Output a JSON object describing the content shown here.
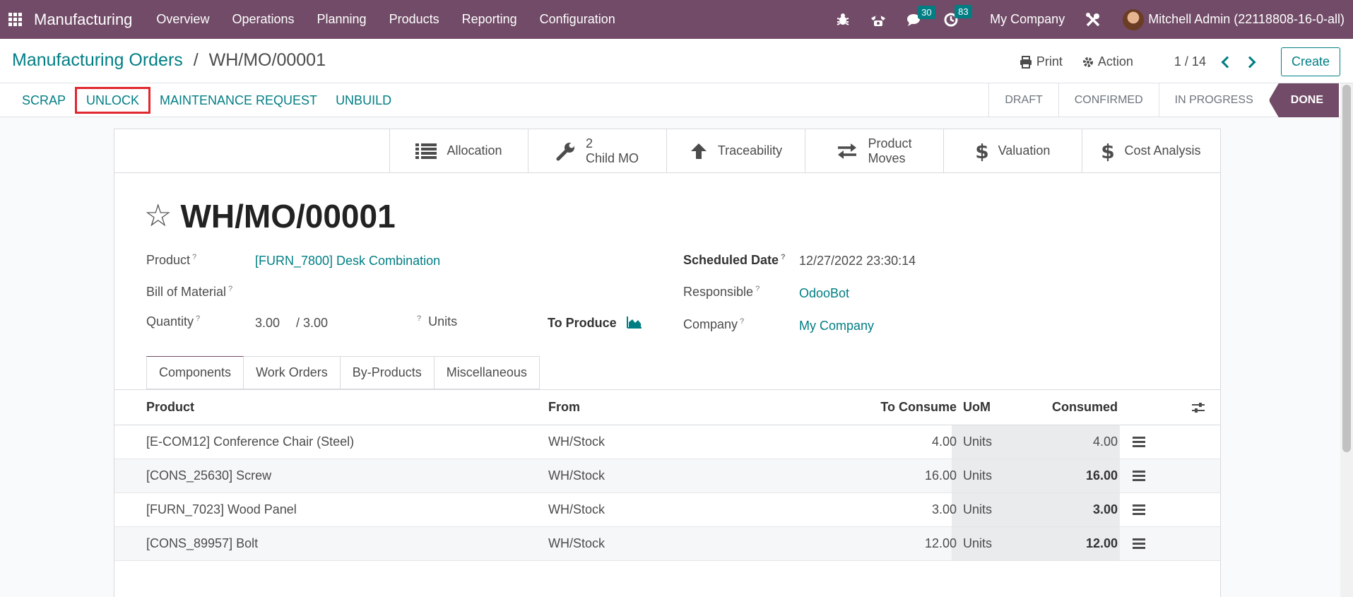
{
  "navbar": {
    "brand": "Manufacturing",
    "menu": [
      "Overview",
      "Operations",
      "Planning",
      "Products",
      "Reporting",
      "Configuration"
    ],
    "chat_count": "30",
    "activity_count": "83",
    "company": "My Company",
    "user": "Mitchell Admin (22118808-16-0-all)"
  },
  "breadcrumb": {
    "parent": "Manufacturing Orders",
    "separator": "/",
    "current": "WH/MO/00001"
  },
  "control": {
    "print": "Print",
    "action": "Action",
    "pager": "1 / 14",
    "create": "Create"
  },
  "header_buttons": {
    "scrap": "SCRAP",
    "unlock": "UNLOCK",
    "maintenance": "MAINTENANCE REQUEST",
    "unbuild": "UNBUILD"
  },
  "stages": [
    "DRAFT",
    "CONFIRMED",
    "IN PROGRESS",
    "DONE"
  ],
  "smart_buttons": {
    "allocation": "Allocation",
    "child_mo_count": "2",
    "child_mo": "Child MO",
    "traceability": "Traceability",
    "product_moves_1": "Product",
    "product_moves_2": "Moves",
    "valuation": "Valuation",
    "cost_analysis": "Cost Analysis"
  },
  "form": {
    "title": "WH/MO/00001",
    "product_label": "Product",
    "product_value": "[FURN_7800] Desk Combination",
    "bom_label": "Bill of Material",
    "quantity_label": "Quantity",
    "quantity_value": "3.00",
    "quantity_total": "/ 3.00",
    "uom_value": "Units",
    "to_produce_label": "To Produce",
    "scheduled_label": "Scheduled Date",
    "scheduled_value": "12/27/2022 23:30:14",
    "responsible_label": "Responsible",
    "responsible_value": "OdooBot",
    "company_label": "Company",
    "company_value": "My Company",
    "help_mark": "?"
  },
  "tabs": [
    "Components",
    "Work Orders",
    "By-Products",
    "Miscellaneous"
  ],
  "table": {
    "headers": {
      "product": "Product",
      "from": "From",
      "to_consume": "To Consume",
      "uom": "UoM",
      "consumed": "Consumed"
    },
    "rows": [
      {
        "product": "[E-COM12] Conference Chair (Steel)",
        "from": "WH/Stock",
        "to_consume": "4.00",
        "uom": "Units",
        "consumed": "4.00"
      },
      {
        "product": "[CONS_25630] Screw",
        "from": "WH/Stock",
        "to_consume": "16.00",
        "uom": "Units",
        "consumed": "16.00"
      },
      {
        "product": "[FURN_7023] Wood Panel",
        "from": "WH/Stock",
        "to_consume": "3.00",
        "uom": "Units",
        "consumed": "3.00"
      },
      {
        "product": "[CONS_89957] Bolt",
        "from": "WH/Stock",
        "to_consume": "12.00",
        "uom": "Units",
        "consumed": "12.00"
      }
    ]
  },
  "colors": {
    "brand": "#714b67",
    "accent": "#017e84",
    "highlight_box": "#e0282e"
  }
}
